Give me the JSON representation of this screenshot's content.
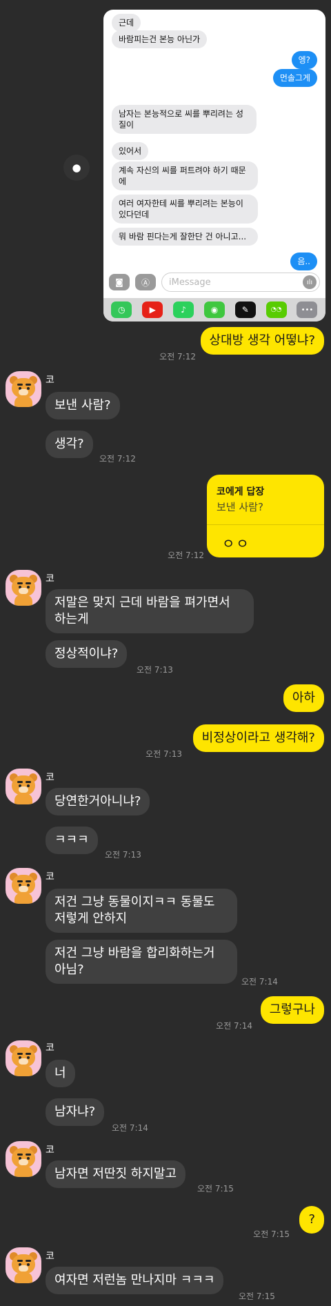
{
  "screenshot": {
    "messages": [
      {
        "side": "left",
        "text": "근데"
      },
      {
        "side": "left",
        "text": "바람피는건 본능 아닌가"
      },
      {
        "side": "right",
        "text": "엥?"
      },
      {
        "side": "right",
        "text": "먼솔그게"
      },
      {
        "side": "left",
        "text": "남자는 본능적으로 씨를 뿌리려는 성\n질이"
      },
      {
        "side": "left",
        "text": "있어서"
      },
      {
        "side": "left",
        "text": "계속 자신의 씨를 퍼트려야 하기 때문\n에"
      },
      {
        "side": "left",
        "text": "여러 여자한테 씨를 뿌리려는 본능이\n있다던데"
      },
      {
        "side": "left",
        "text": "뭐 바람 핀다는게 잘한단 건 아니고..."
      },
      {
        "side": "right",
        "text": "음.."
      }
    ],
    "input_placeholder": "iMessage",
    "camera_icon": "camera-icon",
    "appstore_icon": "appstore-icon",
    "apps": [
      {
        "name": "findmy",
        "color": "#34c759",
        "glyph": "◷"
      },
      {
        "name": "youtube",
        "color": "#e62117",
        "glyph": "▶"
      },
      {
        "name": "music-b",
        "color": "#2bd15c",
        "glyph": "♪"
      },
      {
        "name": "fitness",
        "color": "#3fc73f",
        "glyph": "◉"
      },
      {
        "name": "editor",
        "color": "#111111",
        "glyph": "✎"
      },
      {
        "name": "duolingo",
        "color": "#58cc02",
        "glyph": "◔◔"
      },
      {
        "name": "more",
        "color": "#8e8e93",
        "glyph": "•••"
      }
    ]
  },
  "sender_name": "코",
  "chat": {
    "m1": {
      "text": "상대방 생각 어떻냐?",
      "time": "오전 7:12"
    },
    "m2": {
      "text": "보낸 사람?"
    },
    "m3": {
      "text": "생각?",
      "time": "오전 7:12"
    },
    "reply": {
      "title": "코에게 답장",
      "quote": "보낸 사람?",
      "text": "ㅇㅇ",
      "time": "오전 7:12"
    },
    "m4": {
      "text": "저말은 맞지 근데 바람을 펴가면서\n하는게"
    },
    "m5": {
      "text": "정상적이냐?",
      "time": "오전 7:13"
    },
    "m6": {
      "text": "아하"
    },
    "m7": {
      "text": "비정상이라고 생각해?",
      "time": "오전 7:13"
    },
    "m8": {
      "text": "당연한거아니냐?"
    },
    "m9": {
      "text": "ㅋㅋㅋ",
      "time": "오전 7:13"
    },
    "m10": {
      "text": "저건 그냥 동물이지ㅋㅋ 동물도\n저렇게 안하지"
    },
    "m11": {
      "text": "저건 그냥 바람을 합리화하는거\n아님?",
      "time": "오전 7:14"
    },
    "m12": {
      "text": "그렇구나",
      "time": "오전 7:14"
    },
    "m13": {
      "text": "너"
    },
    "m14": {
      "text": "남자냐?",
      "time": "오전 7:14"
    },
    "m15": {
      "text": "남자면 저딴짓 하지말고",
      "time": "오전 7:15"
    },
    "m16": {
      "text": "?",
      "time": "오전 7:15"
    },
    "m17": {
      "text": "여자면 저런놈 만나지마 ㅋㅋㅋ",
      "time": "오전 7:15"
    }
  }
}
